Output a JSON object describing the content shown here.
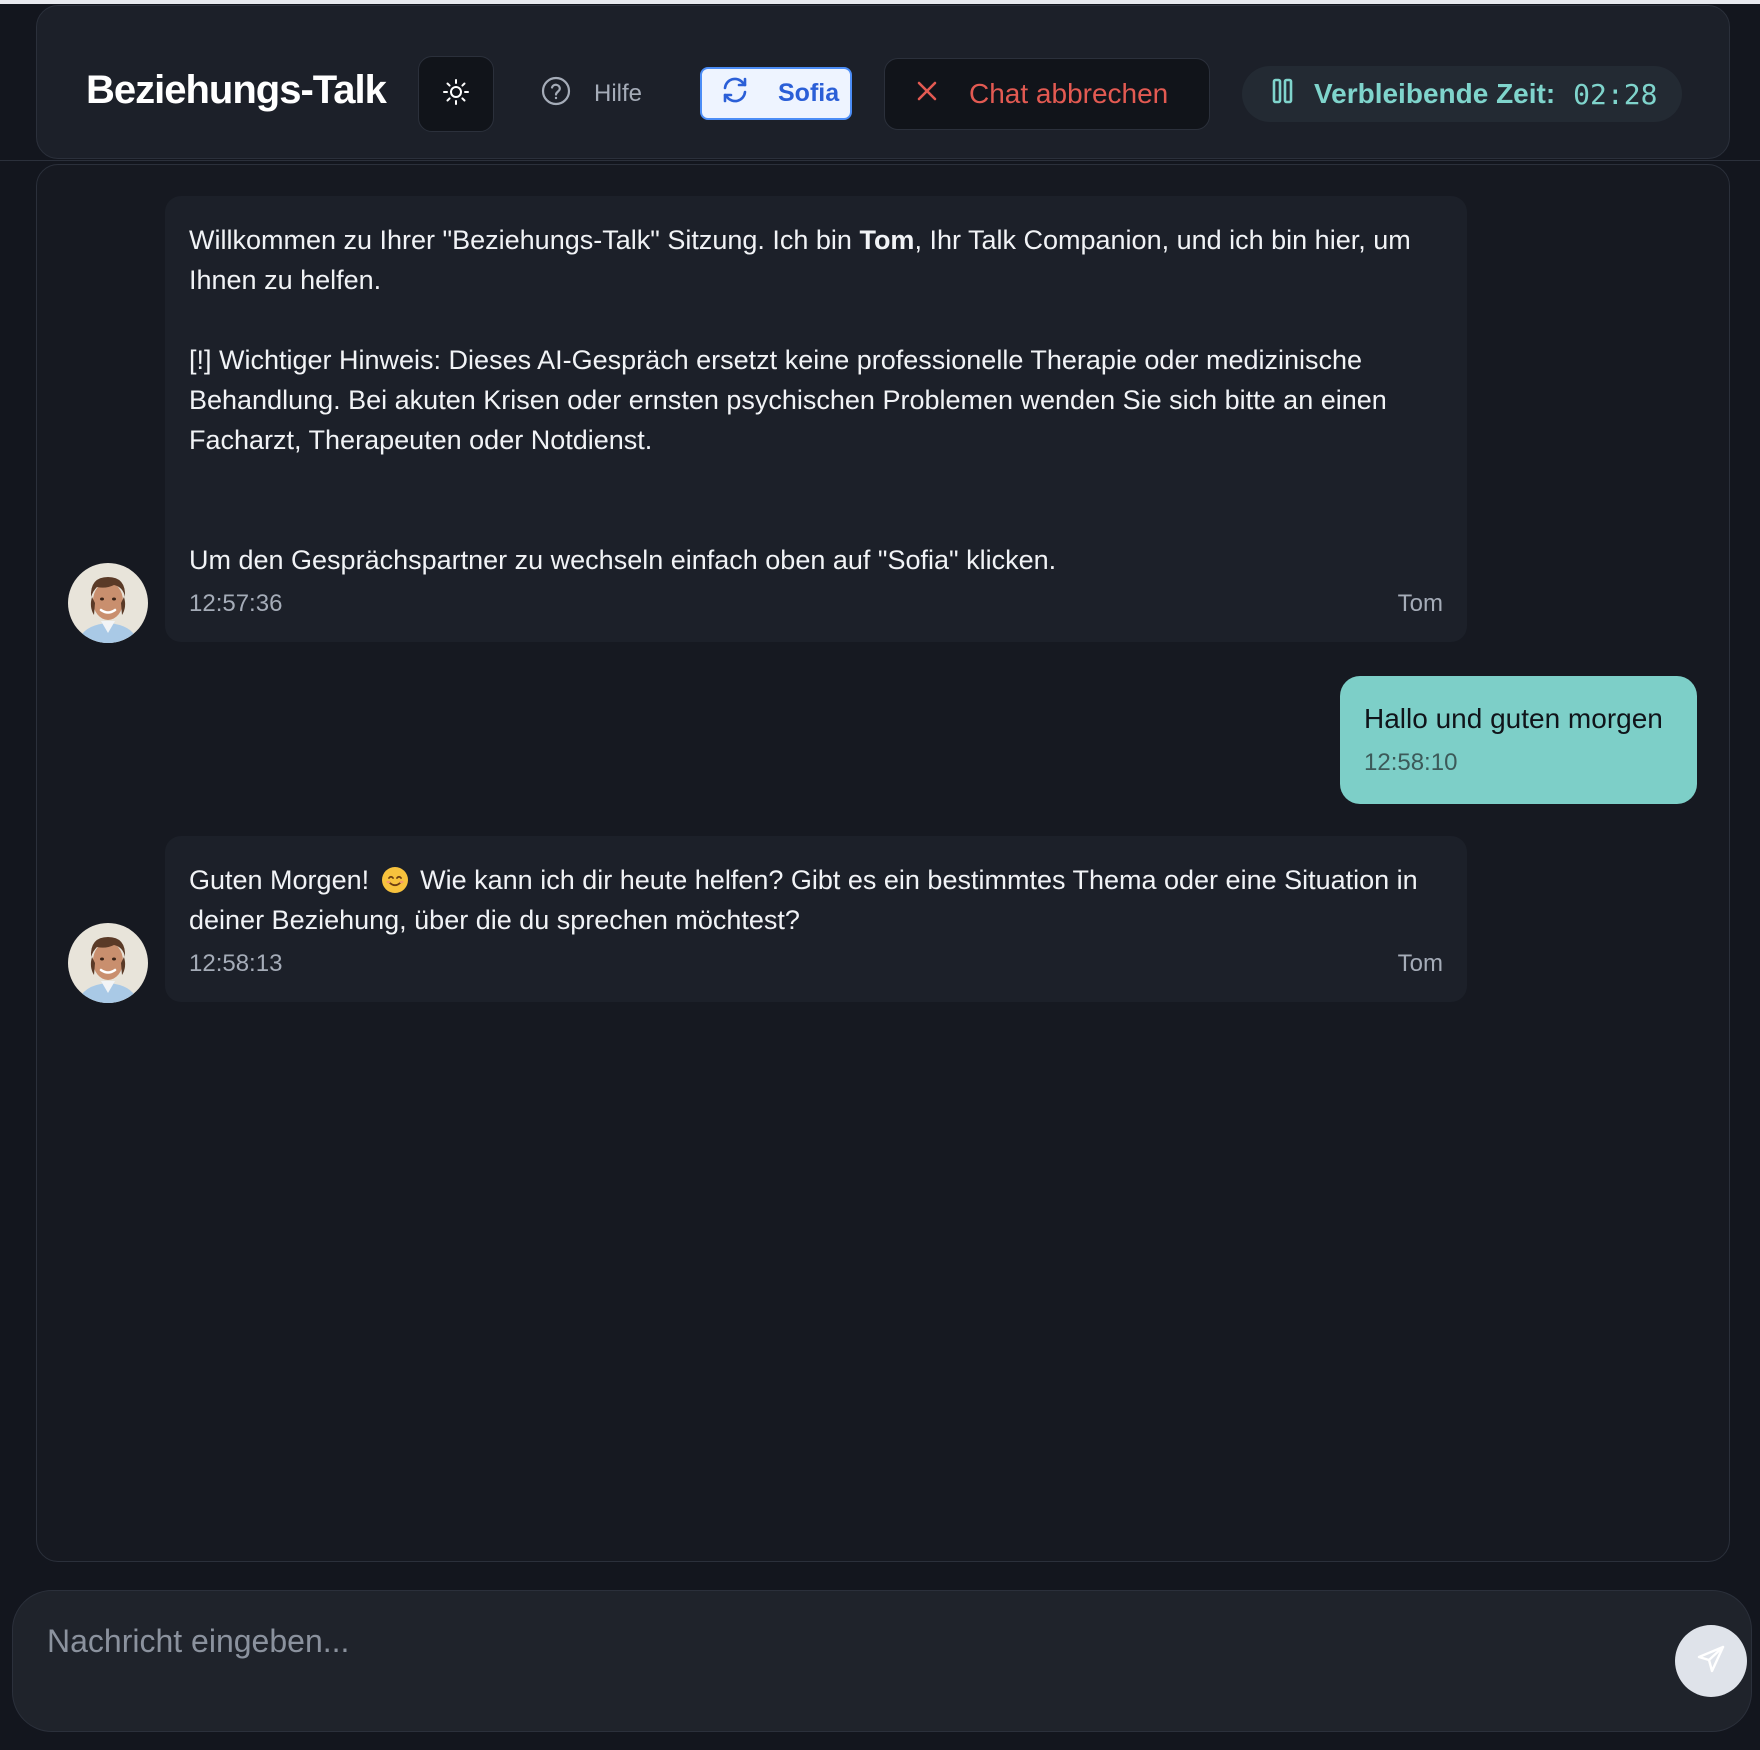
{
  "header": {
    "title": "Beziehungs-Talk",
    "help_label": "Hilfe",
    "switch_label": "Sofia",
    "cancel_label": "Chat abbrechen",
    "timer_label": "Verbleibende Zeit:",
    "timer_value": "02:28"
  },
  "messages": [
    {
      "sender": "Tom",
      "time": "12:57:36",
      "p1_a": "Willkommen zu Ihrer \"Beziehungs-Talk\" Sitzung. Ich bin ",
      "p1_bold": "Tom",
      "p1_b": ", Ihr Talk Companion, und ich bin hier, um Ihnen zu helfen.",
      "p2": "[!] Wichtiger Hinweis: Dieses AI-Gespräch ersetzt keine professionelle Therapie oder medizinische Behandlung. Bei akuten Krisen oder ernsten psychischen Problemen wenden Sie sich bitte an einen Facharzt, Therapeuten oder Notdienst.",
      "p3": "Um den Gesprächspartner zu wechseln einfach oben auf \"Sofia\" klicken."
    },
    {
      "sender": "user",
      "text": "Hallo und guten morgen",
      "time": "12:58:10"
    },
    {
      "sender": "Tom",
      "time": "12:58:13",
      "text_a": "Guten Morgen!",
      "text_b": "Wie kann ich dir heute helfen? Gibt es ein bestimmtes Thema oder eine Situation in deiner Beziehung, über die du sprechen möchtest?"
    }
  ],
  "input": {
    "placeholder": "Nachricht eingeben..."
  },
  "icons": {
    "theme": "sun-icon",
    "help": "question-circle-icon",
    "switch": "refresh-icon",
    "cancel": "close-icon",
    "timer": "pause-icon",
    "send": "send-icon",
    "avatar": "tom-avatar",
    "emoji": "smiling-face-emoji"
  },
  "colors": {
    "accent_teal": "#7dcfc8",
    "cancel_red": "#e35a52",
    "switch_blue": "#2b5fd7",
    "panel_bg": "#161921"
  }
}
